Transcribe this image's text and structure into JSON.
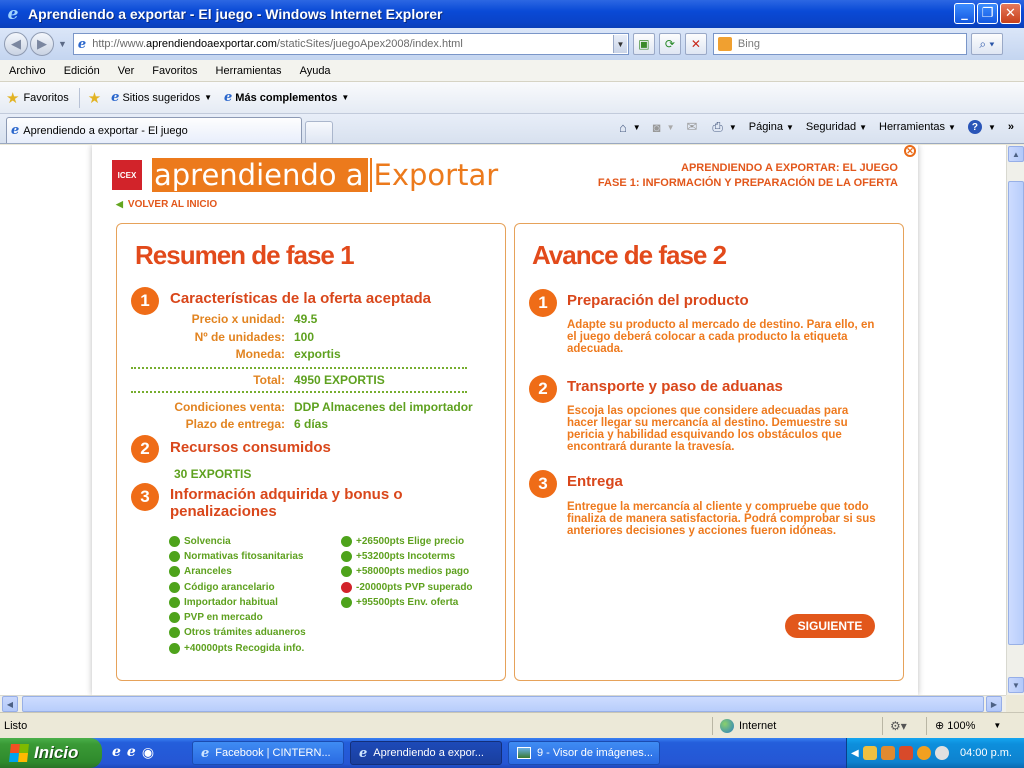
{
  "window": {
    "title": "Aprendiendo a exportar - El juego - Windows Internet Explorer",
    "minimize": "_",
    "restore": "❐",
    "close": "✕"
  },
  "addressbar": {
    "url_prefix": "http://www.",
    "url_domain": "aprendiendoaexportar.com",
    "url_path": "/staticSites/juegoApex2008/index.html",
    "search_placeholder": "Bing"
  },
  "menubar": [
    "Archivo",
    "Edición",
    "Ver",
    "Favoritos",
    "Herramientas",
    "Ayuda"
  ],
  "favbar": {
    "favorites": "Favoritos",
    "suggested": "Sitios sugeridos",
    "addons": "Más complementos"
  },
  "tab": {
    "label": "Aprendiendo a exportar - El juego"
  },
  "commandbar": {
    "page": "Página",
    "security": "Seguridad",
    "tools": "Herramientas"
  },
  "game": {
    "logo_part1": "aprendiendo a",
    "logo_part2": "Exportar",
    "icex": "ICEX",
    "header_line1": "APRENDIENDO A EXPORTAR: EL JUEGO",
    "header_line2": "FASE 1: INFORMACIÓN Y PREPARACIÓN DE LA OFERTA",
    "back": "VOLVER AL INICIO",
    "left": {
      "title": "Resumen de fase 1",
      "s1_title": "Características de la oferta aceptada",
      "price_label": "Precio x unidad:",
      "price_value": "49.5",
      "units_label": "Nº de unidades:",
      "units_value": "100",
      "currency_label": "Moneda:",
      "currency_value": "exportis",
      "total_label": "Total:",
      "total_value": "4950 EXPORTIS",
      "conditions_label": "Condiciones venta:",
      "conditions_value": "DDP Almacenes del importador",
      "delivery_label": "Plazo de entrega:",
      "delivery_value": "6 días",
      "s2_title": "Recursos consumidos",
      "resources_value": "30 EXPORTIS",
      "s3_title_line1": "Información adquirida y bonus o",
      "s3_title_line2": "penalizaciones",
      "bonus_col1": [
        "Solvencia",
        "Normativas fitosanitarias",
        "Aranceles",
        "Código arancelario",
        "Importador habitual",
        "PVP en mercado",
        "Otros trámites aduaneros",
        "+40000pts Recogida info."
      ],
      "bonus_col2": [
        "+26500pts Elige precio",
        "+53200pts Incoterms",
        "+58000pts medios pago",
        "-20000pts PVP superado",
        "+95500pts Env. oferta"
      ]
    },
    "right": {
      "title": "Avance de fase 2",
      "s1_title": "Preparación del producto",
      "s1_text": "Adapte su producto al mercado de destino. Para ello, en el juego deberá colocar a cada producto la etiqueta adecuada.",
      "s2_title": "Transporte y paso de aduanas",
      "s2_text": "Escoja las opciones que considere adecuadas para hacer llegar su mercancía al destino. Demuestre su pericia y habilidad esquivando los obstáculos que encontrará durante la travesía.",
      "s3_title": "Entrega",
      "s3_text": "Entregue la mercancía al cliente y compruebe que todo finaliza de manera satisfactoria. Podrá comprobar si sus anteriores decisiones y acciones fueron idóneas.",
      "next": "SIGUIENTE"
    },
    "numbers": [
      "1",
      "2",
      "3"
    ]
  },
  "statusbar": {
    "status": "Listo",
    "zone": "Internet",
    "zoom": "100%"
  },
  "taskbar": {
    "start": "Inicio",
    "tasks": [
      "Facebook | CINTERN...",
      "Aprendiendo a expor...",
      "9 - Visor de imágenes..."
    ],
    "clock": "04:00 p.m."
  },
  "colors": {
    "accent_orange": "#e2571b",
    "title_red": "#e24a1b",
    "value_green": "#5ea11f",
    "penalty_red": "#d2232a"
  }
}
